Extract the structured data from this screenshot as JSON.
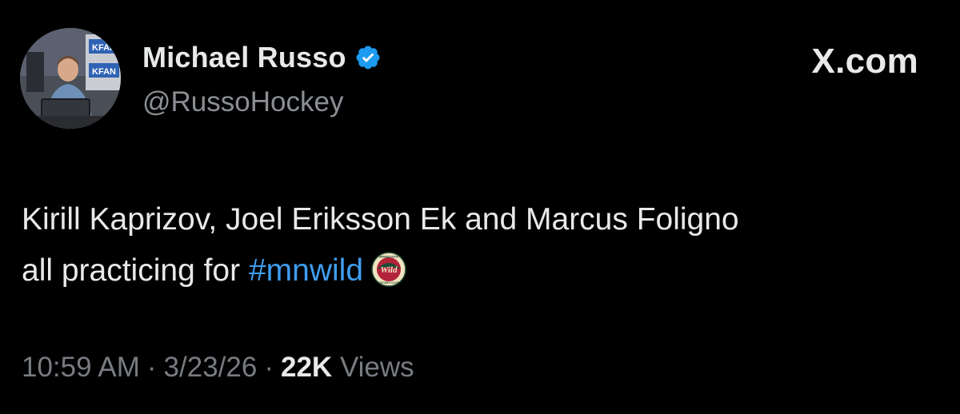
{
  "author": {
    "display_name": "Michael Russo",
    "handle": "@RussoHockey",
    "verified": true,
    "avatar_signage": [
      "KFAN",
      "KFAN"
    ]
  },
  "brand": {
    "label": "X.com"
  },
  "tweet": {
    "line1": "Kirill Kaprizov, Joel Eriksson Ek and Marcus Foligno",
    "line2_prefix": "all practicing for ",
    "hashtag": "#mnwild",
    "emoji": "minnesota-wild-logo-icon",
    "emoji_text": [
      "MINNESOTA",
      "Wild",
      "HOCKEY CLUB"
    ]
  },
  "meta": {
    "time": "10:59 AM",
    "separator": "·",
    "date": "3/23/26",
    "views_count": "22K",
    "views_label": "Views"
  },
  "colors": {
    "background": "#000000",
    "text": "#e7e9ea",
    "secondary": "#8b8f94",
    "hashtag": "#3f9df0",
    "verified_badge": "#1d9bf0"
  }
}
